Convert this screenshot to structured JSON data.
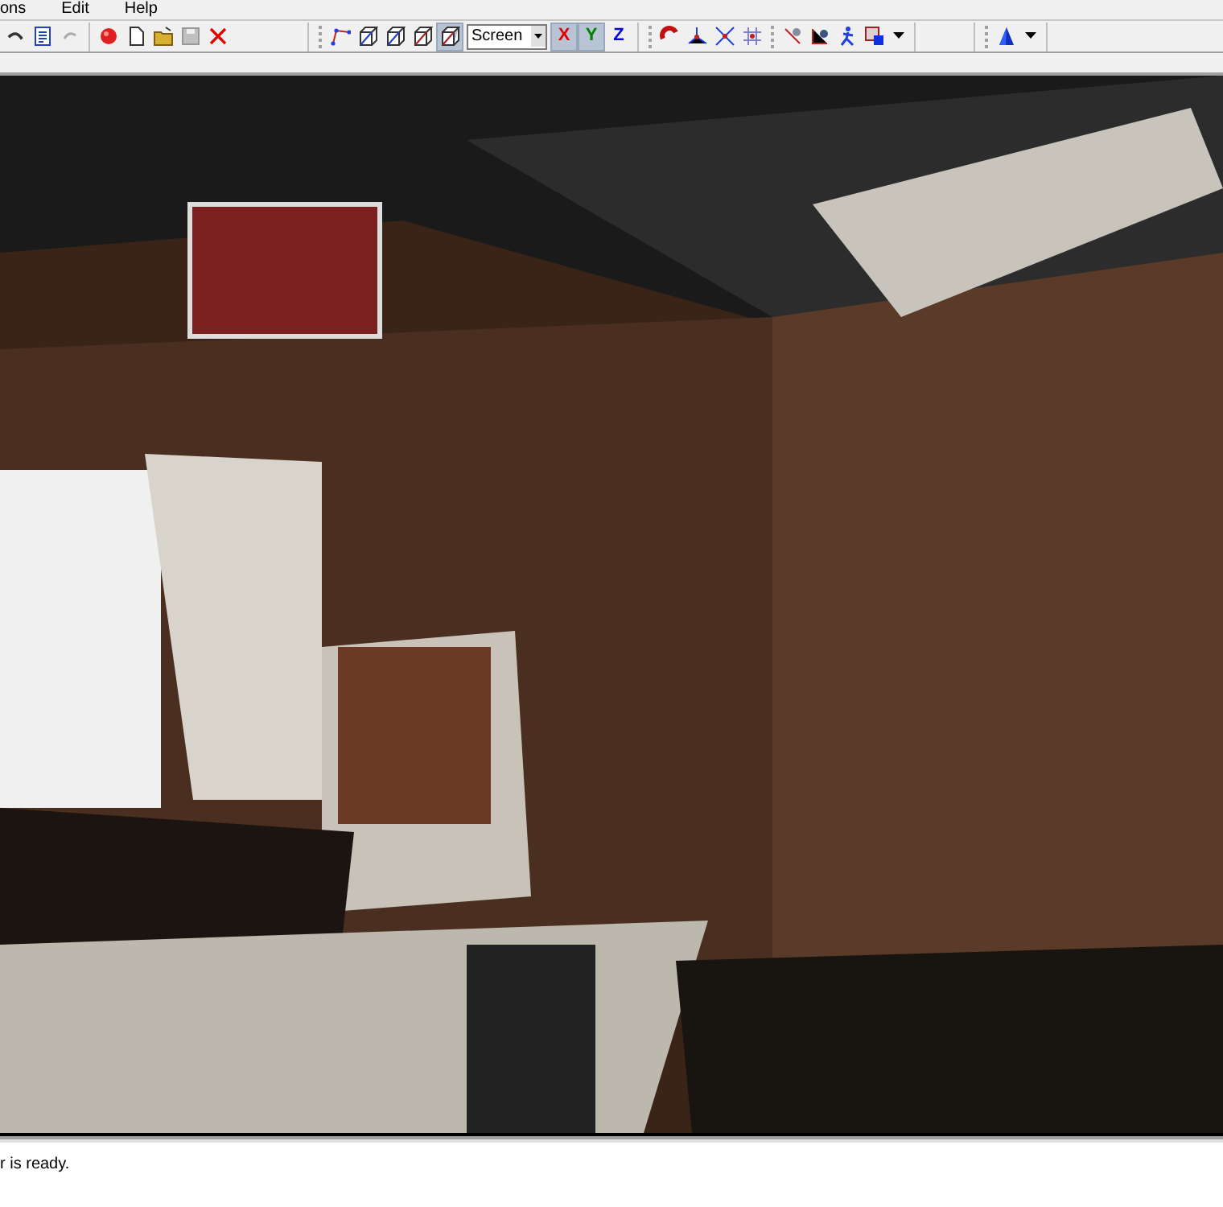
{
  "menu": [
    {
      "label": "ons"
    },
    {
      "label": "Edit"
    },
    {
      "label": "Help"
    }
  ],
  "projection": {
    "value": "Screen"
  },
  "view_cube_buttons": [
    {
      "pressed": false
    },
    {
      "pressed": false
    },
    {
      "pressed": false
    },
    {
      "pressed": true
    }
  ],
  "axis_buttons": [
    {
      "label": "X",
      "pressed": true,
      "color": "#e00000"
    },
    {
      "label": "Y",
      "pressed": true,
      "color": "#008000"
    },
    {
      "label": "Z",
      "pressed": false,
      "color": "#0000e0"
    }
  ],
  "status_bar": {
    "text": "r is ready."
  }
}
